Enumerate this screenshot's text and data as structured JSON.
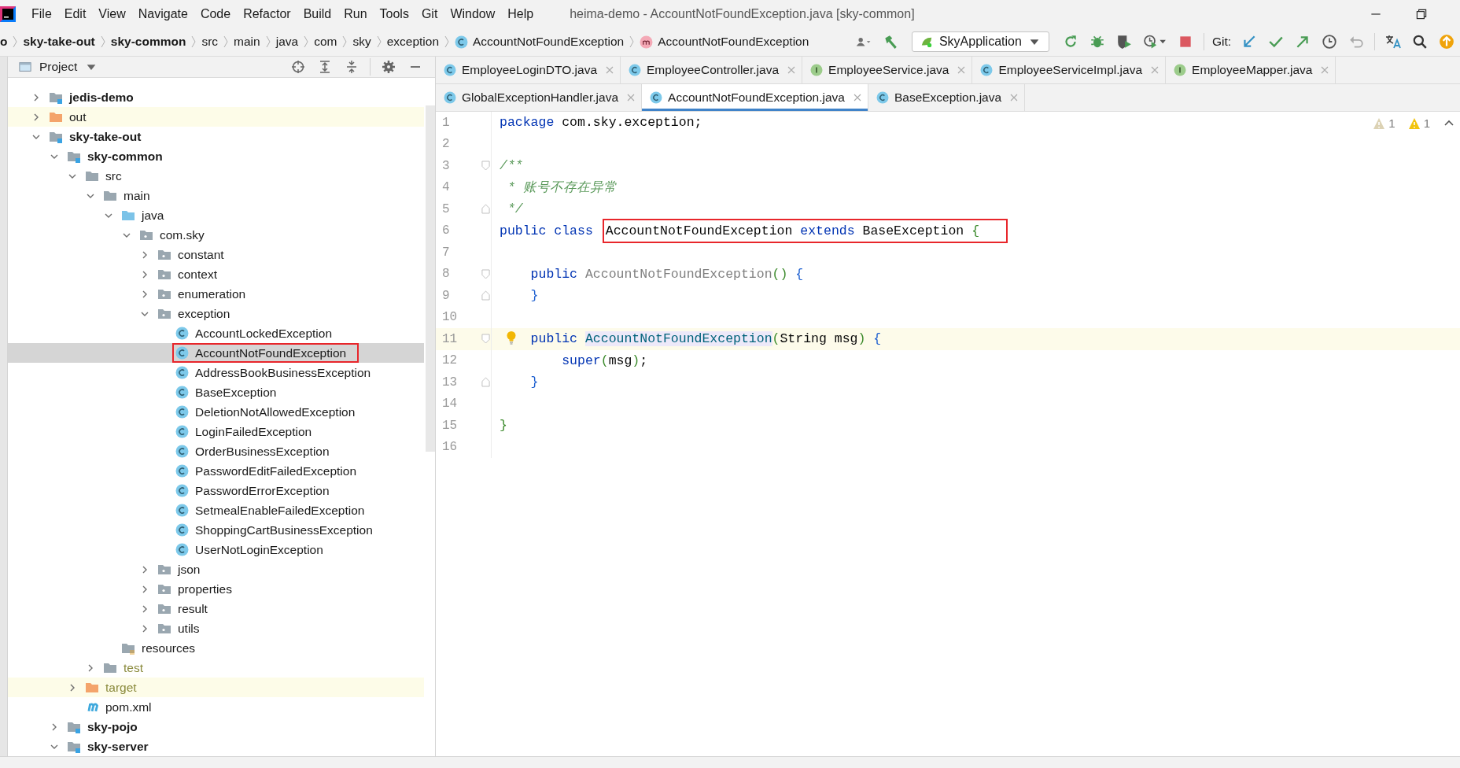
{
  "window": {
    "title": "heima-demo - AccountNotFoundException.java [sky-common]"
  },
  "menu": [
    "File",
    "Edit",
    "View",
    "Navigate",
    "Code",
    "Refactor",
    "Build",
    "Run",
    "Tools",
    "Git",
    "Window",
    "Help"
  ],
  "breadcrumbs": [
    {
      "text": "o",
      "kind": "module"
    },
    {
      "text": "sky-take-out",
      "kind": "module"
    },
    {
      "text": "sky-common",
      "kind": "module"
    },
    {
      "text": "src",
      "kind": "plain"
    },
    {
      "text": "main",
      "kind": "plain"
    },
    {
      "text": "java",
      "kind": "plain"
    },
    {
      "text": "com",
      "kind": "plain"
    },
    {
      "text": "sky",
      "kind": "plain"
    },
    {
      "text": "exception",
      "kind": "plain"
    },
    {
      "text": "AccountNotFoundException",
      "kind": "class"
    },
    {
      "text": "AccountNotFoundException",
      "kind": "method"
    }
  ],
  "run_config": "SkyApplication",
  "git_label": "Git:",
  "project_panel": {
    "title": "Project"
  },
  "tree": [
    {
      "label": "jedis-demo",
      "kind": "module",
      "expanded": false,
      "selected": false,
      "ignored": false,
      "boxed": false
    },
    {
      "label": "out",
      "kind": "excluded",
      "expanded": false,
      "selected": false,
      "ignored": false,
      "boxed": false
    },
    {
      "label": "sky-take-out",
      "kind": "module",
      "expanded": true,
      "selected": false,
      "ignored": false,
      "boxed": false,
      "children": [
        {
          "label": "sky-common",
          "kind": "module",
          "expanded": true,
          "selected": false,
          "ignored": false,
          "boxed": false,
          "children": [
            {
              "label": "src",
              "kind": "folder",
              "expanded": true,
              "selected": false,
              "ignored": false,
              "boxed": false,
              "children": [
                {
                  "label": "main",
                  "kind": "folder",
                  "expanded": true,
                  "selected": false,
                  "ignored": false,
                  "boxed": false,
                  "children": [
                    {
                      "label": "java",
                      "kind": "source-root",
                      "expanded": true,
                      "selected": false,
                      "ignored": false,
                      "boxed": false,
                      "children": [
                        {
                          "label": "com.sky",
                          "kind": "package",
                          "expanded": true,
                          "selected": false,
                          "ignored": false,
                          "boxed": false,
                          "children": [
                            {
                              "label": "constant",
                              "kind": "package",
                              "expanded": false,
                              "selected": false,
                              "ignored": false,
                              "boxed": false
                            },
                            {
                              "label": "context",
                              "kind": "package",
                              "expanded": false,
                              "selected": false,
                              "ignored": false,
                              "boxed": false
                            },
                            {
                              "label": "enumeration",
                              "kind": "package",
                              "expanded": false,
                              "selected": false,
                              "ignored": false,
                              "boxed": false
                            },
                            {
                              "label": "exception",
                              "kind": "package",
                              "expanded": true,
                              "selected": false,
                              "ignored": false,
                              "boxed": false,
                              "children": [
                                {
                                  "label": "AccountLockedException",
                                  "kind": "class",
                                  "selected": false,
                                  "ignored": false,
                                  "boxed": false
                                },
                                {
                                  "label": "AccountNotFoundException",
                                  "kind": "class",
                                  "selected": true,
                                  "ignored": false,
                                  "boxed": true
                                },
                                {
                                  "label": "AddressBookBusinessException",
                                  "kind": "class",
                                  "selected": false,
                                  "ignored": false,
                                  "boxed": false
                                },
                                {
                                  "label": "BaseException",
                                  "kind": "class",
                                  "selected": false,
                                  "ignored": false,
                                  "boxed": false
                                },
                                {
                                  "label": "DeletionNotAllowedException",
                                  "kind": "class",
                                  "selected": false,
                                  "ignored": false,
                                  "boxed": false
                                },
                                {
                                  "label": "LoginFailedException",
                                  "kind": "class",
                                  "selected": false,
                                  "ignored": false,
                                  "boxed": false
                                },
                                {
                                  "label": "OrderBusinessException",
                                  "kind": "class",
                                  "selected": false,
                                  "ignored": false,
                                  "boxed": false
                                },
                                {
                                  "label": "PasswordEditFailedException",
                                  "kind": "class",
                                  "selected": false,
                                  "ignored": false,
                                  "boxed": false
                                },
                                {
                                  "label": "PasswordErrorException",
                                  "kind": "class",
                                  "selected": false,
                                  "ignored": false,
                                  "boxed": false
                                },
                                {
                                  "label": "SetmealEnableFailedException",
                                  "kind": "class",
                                  "selected": false,
                                  "ignored": false,
                                  "boxed": false
                                },
                                {
                                  "label": "ShoppingCartBusinessException",
                                  "kind": "class",
                                  "selected": false,
                                  "ignored": false,
                                  "boxed": false
                                },
                                {
                                  "label": "UserNotLoginException",
                                  "kind": "class",
                                  "selected": false,
                                  "ignored": false,
                                  "boxed": false
                                }
                              ]
                            },
                            {
                              "label": "json",
                              "kind": "package",
                              "expanded": false,
                              "selected": false,
                              "ignored": false,
                              "boxed": false
                            },
                            {
                              "label": "properties",
                              "kind": "package",
                              "expanded": false,
                              "selected": false,
                              "ignored": false,
                              "boxed": false
                            },
                            {
                              "label": "result",
                              "kind": "package",
                              "expanded": false,
                              "selected": false,
                              "ignored": false,
                              "boxed": false
                            },
                            {
                              "label": "utils",
                              "kind": "package",
                              "expanded": false,
                              "selected": false,
                              "ignored": false,
                              "boxed": false
                            }
                          ]
                        }
                      ]
                    },
                    {
                      "label": "resources",
                      "kind": "resources-root",
                      "selected": false,
                      "ignored": false,
                      "boxed": false
                    }
                  ]
                },
                {
                  "label": "test",
                  "kind": "folder",
                  "expanded": false,
                  "selected": false,
                  "ignored": true,
                  "boxed": false
                }
              ]
            },
            {
              "label": "target",
              "kind": "excluded",
              "expanded": false,
              "selected": false,
              "ignored": true,
              "boxed": false
            },
            {
              "label": "pom.xml",
              "kind": "maven",
              "selected": false,
              "ignored": false,
              "boxed": false
            }
          ]
        },
        {
          "label": "sky-pojo",
          "kind": "module",
          "expanded": false,
          "selected": false,
          "ignored": false,
          "boxed": false
        },
        {
          "label": "sky-server",
          "kind": "module",
          "expanded": true,
          "selected": false,
          "ignored": false,
          "boxed": false
        }
      ]
    }
  ],
  "tab_rows": [
    {
      "tabs": [
        {
          "label": "EmployeeLoginDTO.java",
          "kind": "class",
          "selected": false
        },
        {
          "label": "EmployeeController.java",
          "kind": "class",
          "selected": false
        },
        {
          "label": "EmployeeService.java",
          "kind": "interface",
          "selected": false
        },
        {
          "label": "EmployeeServiceImpl.java",
          "kind": "class",
          "selected": false
        },
        {
          "label": "EmployeeMapper.java",
          "kind": "interface",
          "selected": false
        }
      ]
    },
    {
      "tabs": [
        {
          "label": "GlobalExceptionHandler.java",
          "kind": "class",
          "selected": false
        },
        {
          "label": "AccountNotFoundException.java",
          "kind": "class",
          "selected": true
        },
        {
          "label": "BaseException.java",
          "kind": "class",
          "selected": false
        }
      ]
    }
  ],
  "inspections": [
    {
      "kind": "weak-warning",
      "count": "1"
    },
    {
      "kind": "warning",
      "count": "1"
    }
  ],
  "code_lines": [
    {
      "number": "1",
      "current": false,
      "bulb": false,
      "tokens": [
        {
          "text": "package ",
          "kind": "keyword"
        },
        {
          "text": "com.sky.exception;",
          "kind": "plain"
        }
      ]
    },
    {
      "number": "2",
      "current": false,
      "bulb": false
    },
    {
      "number": "3",
      "current": false,
      "bulb": false,
      "kind": "fold-start",
      "tokens": [
        {
          "text": "/**",
          "kind": "comment"
        }
      ]
    },
    {
      "number": "4",
      "current": false,
      "bulb": false,
      "tokens": [
        {
          "text": " * 账号不存在异常",
          "kind": "comment"
        }
      ]
    },
    {
      "number": "5",
      "current": false,
      "bulb": false,
      "kind": "fold-end",
      "tokens": [
        {
          "text": " */",
          "kind": "comment"
        }
      ]
    },
    {
      "number": "6",
      "current": false,
      "bulb": false,
      "tokens": [
        {
          "text": "public ",
          "kind": "keyword"
        },
        {
          "text": "class ",
          "kind": "keyword"
        }
      ],
      "boxed_tokens": [
        {
          "text": "AccountNotFoundException ",
          "kind": "plain"
        },
        {
          "text": "extends ",
          "kind": "keyword"
        },
        {
          "text": "BaseException ",
          "kind": "plain"
        },
        {
          "text": "{",
          "kind": "bracket-green"
        }
      ]
    },
    {
      "number": "7",
      "current": false,
      "bulb": false
    },
    {
      "number": "8",
      "current": false,
      "bulb": false,
      "kind": "fold-start",
      "tokens": [
        {
          "text": "    public ",
          "kind": "keyword"
        },
        {
          "text": "AccountNotFoundException",
          "kind": "unused"
        },
        {
          "text": "() ",
          "kind": "bracket-green"
        },
        {
          "text": "{",
          "kind": "bracket-blue"
        }
      ]
    },
    {
      "number": "9",
      "current": false,
      "bulb": false,
      "kind": "fold-end",
      "tokens": [
        {
          "text": "    }",
          "kind": "bracket-blue"
        }
      ]
    },
    {
      "number": "10",
      "current": false,
      "bulb": false
    },
    {
      "number": "11",
      "current": true,
      "bulb": true,
      "kind": "fold-start",
      "tokens": [
        {
          "text": "    public ",
          "kind": "keyword"
        },
        {
          "text": "AccountNotFoundException",
          "kind": "method"
        },
        {
          "text": "(",
          "kind": "bracket-green"
        },
        {
          "text": "String msg",
          "kind": "plain"
        },
        {
          "text": ") ",
          "kind": "bracket-green"
        },
        {
          "text": "{",
          "kind": "bracket-blue"
        }
      ]
    },
    {
      "number": "12",
      "current": false,
      "bulb": false,
      "tokens": [
        {
          "text": "        super",
          "kind": "keyword"
        },
        {
          "text": "(",
          "kind": "bracket-green"
        },
        {
          "text": "msg",
          "kind": "plain"
        },
        {
          "text": ")",
          "kind": "bracket-green"
        },
        {
          "text": ";",
          "kind": "plain"
        }
      ]
    },
    {
      "number": "13",
      "current": false,
      "bulb": false,
      "kind": "fold-end",
      "tokens": [
        {
          "text": "    }",
          "kind": "bracket-blue"
        }
      ]
    },
    {
      "number": "14",
      "current": false,
      "bulb": false
    },
    {
      "number": "15",
      "current": false,
      "bulb": false,
      "tokens": [
        {
          "text": "}",
          "kind": "bracket-green"
        }
      ]
    },
    {
      "number": "16",
      "current": false,
      "bulb": false
    }
  ]
}
